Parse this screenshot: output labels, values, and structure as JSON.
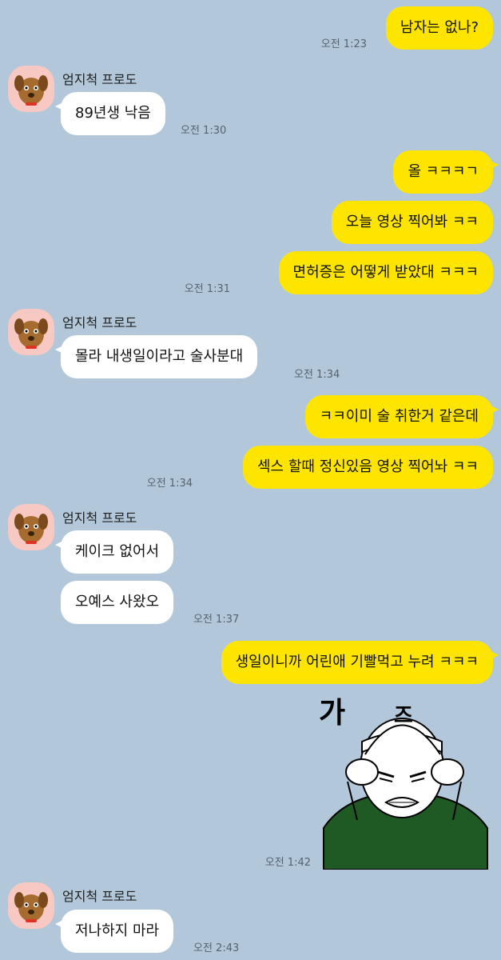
{
  "contact": {
    "name": "엄지척 프로도",
    "avatar_icon": "dog-avatar-icon"
  },
  "messages": [
    {
      "from": "me",
      "text": "남자는 없나?",
      "time": "오전 1:23"
    },
    {
      "from": "them",
      "text": "89년생 낙음",
      "time": "오전 1:30"
    },
    {
      "from": "me",
      "text": "올 ㅋㅋㅋㄱ",
      "time": ""
    },
    {
      "from": "me",
      "text": "오늘 영상 찍어봐 ㅋㅋ",
      "time": ""
    },
    {
      "from": "me",
      "text": "면허증은 어떻게 받았대 ㅋㅋㅋ",
      "time": "오전 1:31"
    },
    {
      "from": "them",
      "text": "몰라 내생일이라고 술사분대",
      "time": "오전 1:34"
    },
    {
      "from": "me",
      "text": "ㅋㅋ이미 술 취한거 같은데",
      "time": ""
    },
    {
      "from": "me",
      "text": "섹스 할때 정신있음 영상 찍어놔 ㅋㅋ",
      "time": "오전 1:34"
    },
    {
      "from": "them",
      "text": "케이크 없어서",
      "time": ""
    },
    {
      "from": "them",
      "text": "오예스 사왔오",
      "time": "오전 1:37"
    },
    {
      "from": "me",
      "text": "생일이니까 어린애 기빨먹고 누려 ㅋㅋㅋ",
      "time": ""
    },
    {
      "from": "me",
      "sticker": "angry-man-sticker",
      "sticker_text": "가즈",
      "time": "오전 1:42"
    },
    {
      "from": "them",
      "text": "저나하지 마라",
      "time": "오전 2:43"
    }
  ],
  "colors": {
    "background": "#b2c7d9",
    "my_bubble": "#fee500",
    "their_bubble": "#ffffff"
  }
}
